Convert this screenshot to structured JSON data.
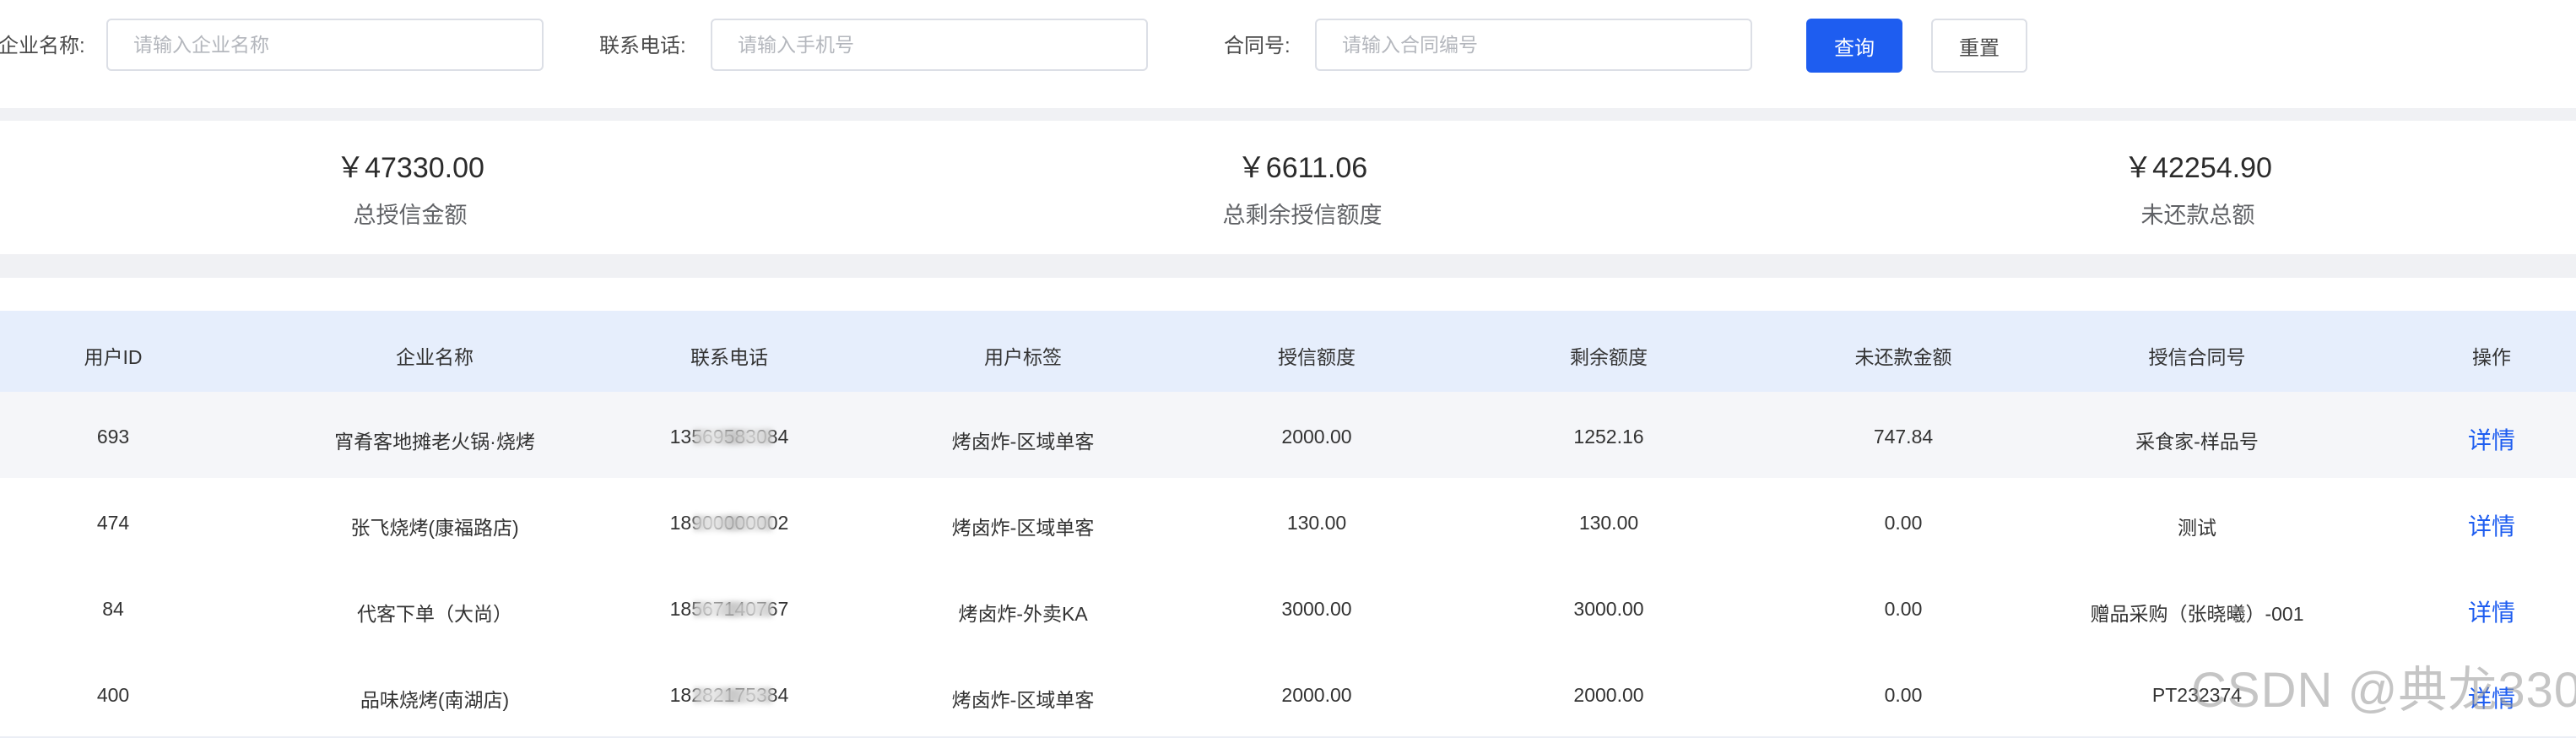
{
  "search": {
    "company_label": "企业名称:",
    "company_placeholder": "请输入企业名称",
    "company_value": "",
    "phone_label": "联系电话:",
    "phone_placeholder": "请输入手机号",
    "phone_value": "",
    "contract_label": "合同号:",
    "contract_placeholder": "请输入合同编号",
    "contract_value": "",
    "query_button": "查询",
    "reset_button": "重置"
  },
  "stats": {
    "total_credit": {
      "value": "￥47330.00",
      "caption": "总授信金额"
    },
    "remaining_credit": {
      "value": "￥6611.06",
      "caption": "总剩余授信额度"
    },
    "unpaid_total": {
      "value": "￥42254.90",
      "caption": "未还款总额"
    }
  },
  "table": {
    "columns": [
      "用户ID",
      "企业名称",
      "联系电话",
      "用户标签",
      "授信额度",
      "剩余额度",
      "未还款金额",
      "授信合同号",
      "操作"
    ],
    "rows": [
      {
        "id": "693",
        "company": "宵肴客地摊老火锅·烧烤",
        "phone": "13569583084",
        "tag": "烤卤炸-区域单客",
        "credit": "2000.00",
        "remaining": "1252.16",
        "unpaid": "747.84",
        "contract": "采食家-样品号",
        "action": "详情"
      },
      {
        "id": "474",
        "company": "张飞烧烤(康福路店)",
        "phone": "18900000002",
        "tag": "烤卤炸-区域单客",
        "credit": "130.00",
        "remaining": "130.00",
        "unpaid": "0.00",
        "contract": "测试",
        "action": "详情"
      },
      {
        "id": "84",
        "company": "代客下单（大尚）",
        "phone": "18567140767",
        "tag": "烤卤炸-外卖KA",
        "credit": "3000.00",
        "remaining": "3000.00",
        "unpaid": "0.00",
        "contract": "赠品采购（张晓曦）-001",
        "action": "详情"
      },
      {
        "id": "400",
        "company": "品味烧烤(南湖店)",
        "phone": "18282175384",
        "tag": "烤卤炸-区域单客",
        "credit": "2000.00",
        "remaining": "2000.00",
        "unpaid": "0.00",
        "contract": "PT232374",
        "action": "详情"
      }
    ]
  },
  "watermark": "CSDN @典龙330"
}
